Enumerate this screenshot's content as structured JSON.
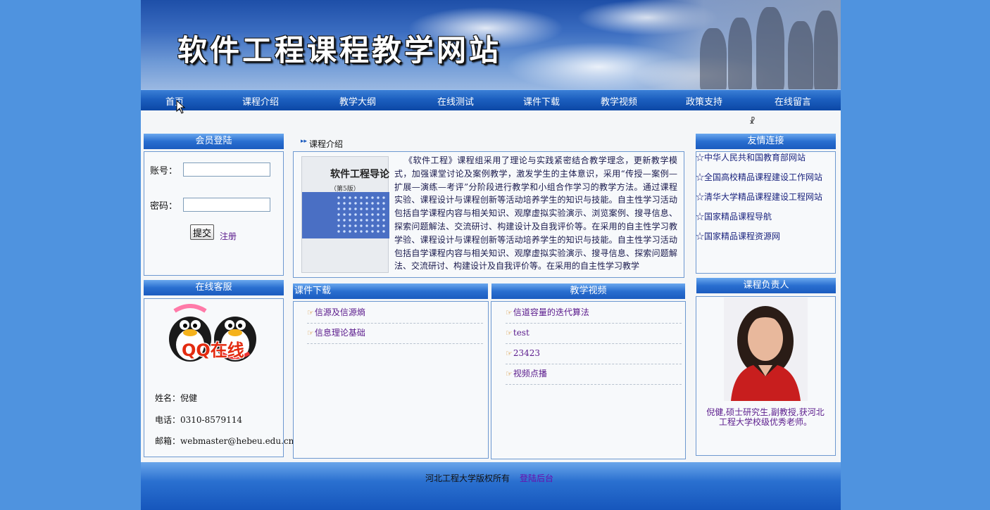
{
  "site": {
    "title": "软件工程课程教学网站"
  },
  "nav": {
    "items": [
      {
        "label": "首页"
      },
      {
        "label": "课程介绍"
      },
      {
        "label": "教学大纲"
      },
      {
        "label": "在线测试"
      },
      {
        "label": "课件下载"
      },
      {
        "label": "教学视频"
      },
      {
        "label": "政策支持"
      },
      {
        "label": "在线留言"
      }
    ]
  },
  "login": {
    "title": "会员登陆",
    "account_label": "账号：",
    "account_value": "",
    "password_label": "密码：",
    "password_value": "",
    "submit_label": "提交",
    "register_label": "注册"
  },
  "service": {
    "title": "在线客服",
    "qq_label": "QQ在线",
    "name": "姓名：倪健",
    "phone": "电话：0310-8579114",
    "email": "邮箱：webmaster@hebeu.edu.cn"
  },
  "intro": {
    "title": "课程介绍",
    "book_title": "软件工程导论",
    "book_edition": "（第5版）",
    "text": "《软件工程》课程组采用了理论与实践紧密结合教学理念，更新教学模式，加强课堂讨论及案例教学，激发学生的主体意识，采用“传授—案例—扩展—演练—考评”分阶段进行教学和小组合作学习的教学方法。通过课程实验、课程设计与课程创新等活动培养学生的知识与技能。自主性学习活动包括自学课程内容与相关知识、观摩虚拟实验演示、浏览案例、搜寻信息、探索问题解法、交流研讨、构建设计及自我评价等。在采用的自主性学习教学验、课程设计与课程创新等活动培养学生的知识与技能。自主性学习活动包括自学课程内容与相关知识、观摩虚拟实验演示、搜寻信息、探索问题解法、交流研讨、构建设计及自我评价等。在采用的自主性学习教学"
  },
  "downloads": {
    "title": "课件下载",
    "items": [
      {
        "label": "信源及信源熵"
      },
      {
        "label": "信息理论基础"
      }
    ]
  },
  "videos": {
    "title": "教学视频",
    "items": [
      {
        "label": "信道容量的迭代算法"
      },
      {
        "label": "test"
      },
      {
        "label": "23423"
      },
      {
        "label": "视频点播"
      }
    ]
  },
  "links": {
    "title": "友情连接",
    "items": [
      {
        "label": "☆中华人民共和国教育部网站"
      },
      {
        "label": "☆全国高校精品课程建设工作网站"
      },
      {
        "label": "☆清华大学精品课程建设工程网站"
      },
      {
        "label": "☆国家精品课程导航"
      },
      {
        "label": "☆国家精品课程资源网"
      }
    ]
  },
  "teacher": {
    "title": "课程负责人",
    "description": "倪健,硕士研究生,副教授,获河北工程大学校级优秀老师。"
  },
  "footer": {
    "copyright": "河北工程大学版权所有",
    "admin_label": "登陆后台"
  },
  "colors": {
    "page_bg": "#4f93df",
    "nav_bg": "#1c5fbf",
    "link": "#5a1a8c"
  }
}
